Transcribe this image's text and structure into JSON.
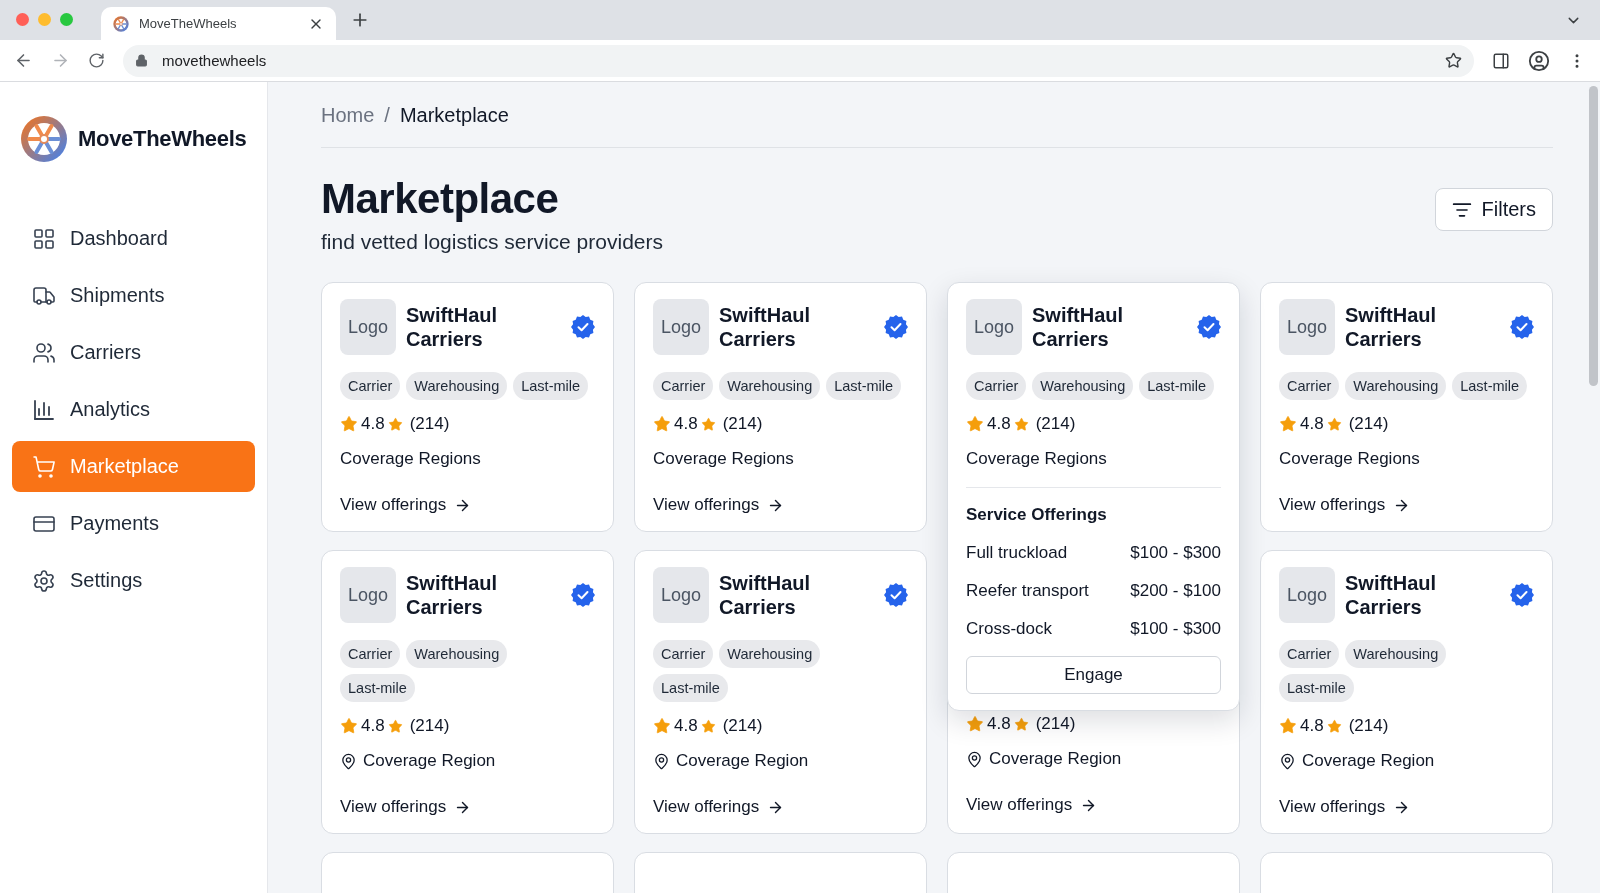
{
  "browser": {
    "tab_title": "MoveTheWheels",
    "url": "movethewheels"
  },
  "sidebar": {
    "brand": "MoveTheWheels",
    "items": [
      {
        "label": "Dashboard",
        "selected": false
      },
      {
        "label": "Shipments",
        "selected": false
      },
      {
        "label": "Carriers",
        "selected": false
      },
      {
        "label": "Analytics",
        "selected": false
      },
      {
        "label": "Marketplace",
        "selected": true
      },
      {
        "label": "Payments",
        "selected": false
      },
      {
        "label": "Settings",
        "selected": false
      }
    ]
  },
  "breadcrumb": {
    "items": [
      "Home",
      "Marketplace"
    ],
    "separator": "/"
  },
  "page": {
    "title": "Marketplace",
    "subtitle": "find vetted logistics service providers",
    "filters_button": "Filters"
  },
  "card_rows": [
    {
      "cards": [
        {
          "kind": "card",
          "logo": "Logo",
          "name": "SwiftHaul Carriers",
          "verified": true,
          "tags": [
            "Carrier",
            "Warehousing",
            "Last-mile"
          ],
          "rating": "4.8",
          "reviews": "(214)",
          "region": "Coverage Regions",
          "region_pin": false,
          "link": "View offerings"
        },
        {
          "kind": "card",
          "logo": "Logo",
          "name": "SwiftHaul Carriers",
          "verified": true,
          "tags": [
            "Carrier",
            "Warehousing",
            "Last-mile"
          ],
          "rating": "4.8",
          "reviews": "(214)",
          "region": "Coverage Regions",
          "region_pin": false,
          "link": "View offerings"
        },
        {
          "kind": "expanded",
          "logo": "Logo",
          "name": "SwiftHaul Carriers",
          "verified": true,
          "tags": [
            "Carrier",
            "Warehousing",
            "Last-mile"
          ],
          "rating": "4.8",
          "reviews": "(214)",
          "region": "Coverage Regions",
          "region_pin": false,
          "offerings_title": "Service Offerings",
          "offerings": [
            {
              "name": "Full truckload",
              "price": "$100 - $300"
            },
            {
              "name": "Reefer transport",
              "price": "$200 - $100"
            },
            {
              "name": "Cross-dock",
              "price": "$100 - $300"
            }
          ],
          "action": "Engage"
        },
        {
          "kind": "card",
          "logo": "Logo",
          "name": "SwiftHaul Carriers",
          "verified": true,
          "tags": [
            "Carrier",
            "Warehousing",
            "Last-mile"
          ],
          "rating": "4.8",
          "reviews": "(214)",
          "region": "Coverage Regions",
          "region_pin": false,
          "link": "View offerings"
        }
      ]
    },
    {
      "cards": [
        {
          "kind": "card",
          "logo": "Logo",
          "name": "SwiftHaul Carriers",
          "verified": true,
          "tags": [
            "Carrier",
            "Warehousing",
            "Last-mile"
          ],
          "rating": "4.8",
          "reviews": "(214)",
          "region": "Coverage Region",
          "region_pin": true,
          "link": "View offerings"
        },
        {
          "kind": "card",
          "logo": "Logo",
          "name": "SwiftHaul Carriers",
          "verified": true,
          "tags": [
            "Carrier",
            "Warehousing",
            "Last-mile"
          ],
          "rating": "4.8",
          "reviews": "(214)",
          "region": "Coverage Region",
          "region_pin": true,
          "link": "View offerings"
        },
        {
          "kind": "covered",
          "rating": "4.8",
          "reviews": "(214)",
          "region": "Coverage Region",
          "region_pin": true,
          "link": "View offerings"
        },
        {
          "kind": "card",
          "logo": "Logo",
          "name": "SwiftHaul Carriers",
          "verified": true,
          "tags": [
            "Carrier",
            "Warehousing",
            "Last-mile"
          ],
          "rating": "4.8",
          "reviews": "(214)",
          "region": "Coverage Region",
          "region_pin": true,
          "link": "View offerings"
        }
      ]
    },
    {
      "cards": [
        {
          "kind": "cut-off"
        },
        {
          "kind": "cut-off"
        },
        {
          "kind": "cut-off"
        },
        {
          "kind": "cut-off"
        }
      ]
    }
  ]
}
